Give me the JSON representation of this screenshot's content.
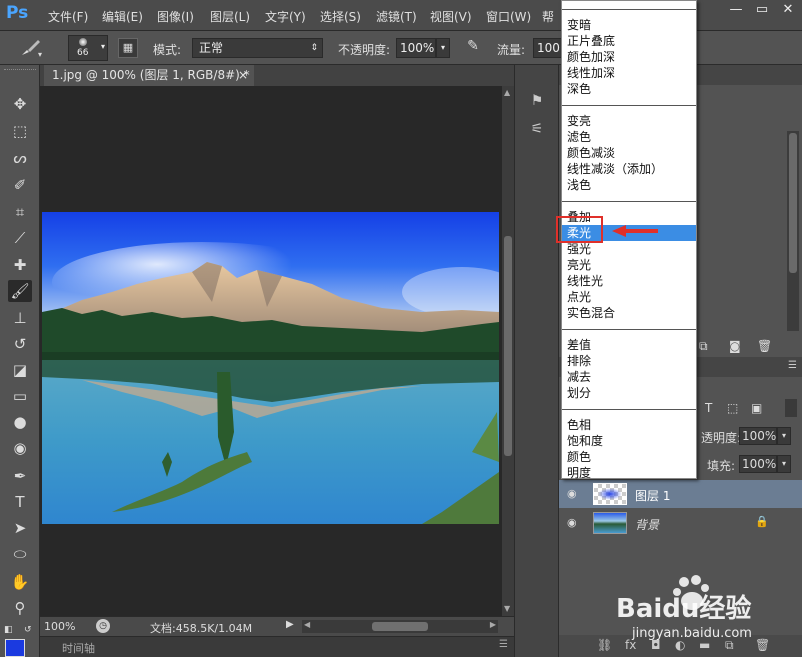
{
  "app": {
    "logo": "Ps"
  },
  "menubar": {
    "items": [
      "文件(F)",
      "编辑(E)",
      "图像(I)",
      "图层(L)",
      "文字(Y)",
      "选择(S)",
      "滤镜(T)",
      "视图(V)",
      "窗口(W)",
      "帮"
    ]
  },
  "window_controls": {
    "minimize": "—",
    "restore": "▭",
    "close": "✕"
  },
  "options": {
    "brush_size": "66",
    "mode_label": "模式:",
    "mode_value": "正常",
    "opacity_label": "不透明度:",
    "opacity_value": "100%",
    "flow_label": "流量:",
    "flow_value": "100"
  },
  "document": {
    "tab_title": "1.jpg @ 100% (图层 1, RGB/8#) *",
    "tab_close": "×"
  },
  "status": {
    "zoom": "100%",
    "doc_size": "文档:458.5K/1.04M"
  },
  "timeline": {
    "label": "时间轴"
  },
  "blend_modes": {
    "groups": [
      [
        "变暗",
        "正片叠底",
        "颜色加深",
        "线性加深",
        "深色"
      ],
      [
        "变亮",
        "滤色",
        "颜色减淡",
        "线性减淡（添加）",
        "浅色"
      ],
      [
        "叠加",
        "柔光",
        "强光",
        "亮光",
        "线性光",
        "点光",
        "实色混合"
      ],
      [
        "差值",
        "排除",
        "减去",
        "划分"
      ],
      [
        "色相",
        "饱和度",
        "颜色",
        "明度"
      ]
    ],
    "selected": "柔光"
  },
  "layers_panel": {
    "opacity_label": "透明度:",
    "opacity_value": "100%",
    "fill_label": "填充:",
    "fill_value": "100%",
    "layers": [
      {
        "name": "图层 1",
        "selected": true
      },
      {
        "name": "背景",
        "locked": true
      }
    ]
  },
  "watermark": {
    "brand": "Baidu经验",
    "url": "jingyan.baidu.com"
  },
  "colors": {
    "selection_blue": "#3b8de4",
    "annotation_red": "#e0302a",
    "ps_blue": "#4aa5ff"
  }
}
